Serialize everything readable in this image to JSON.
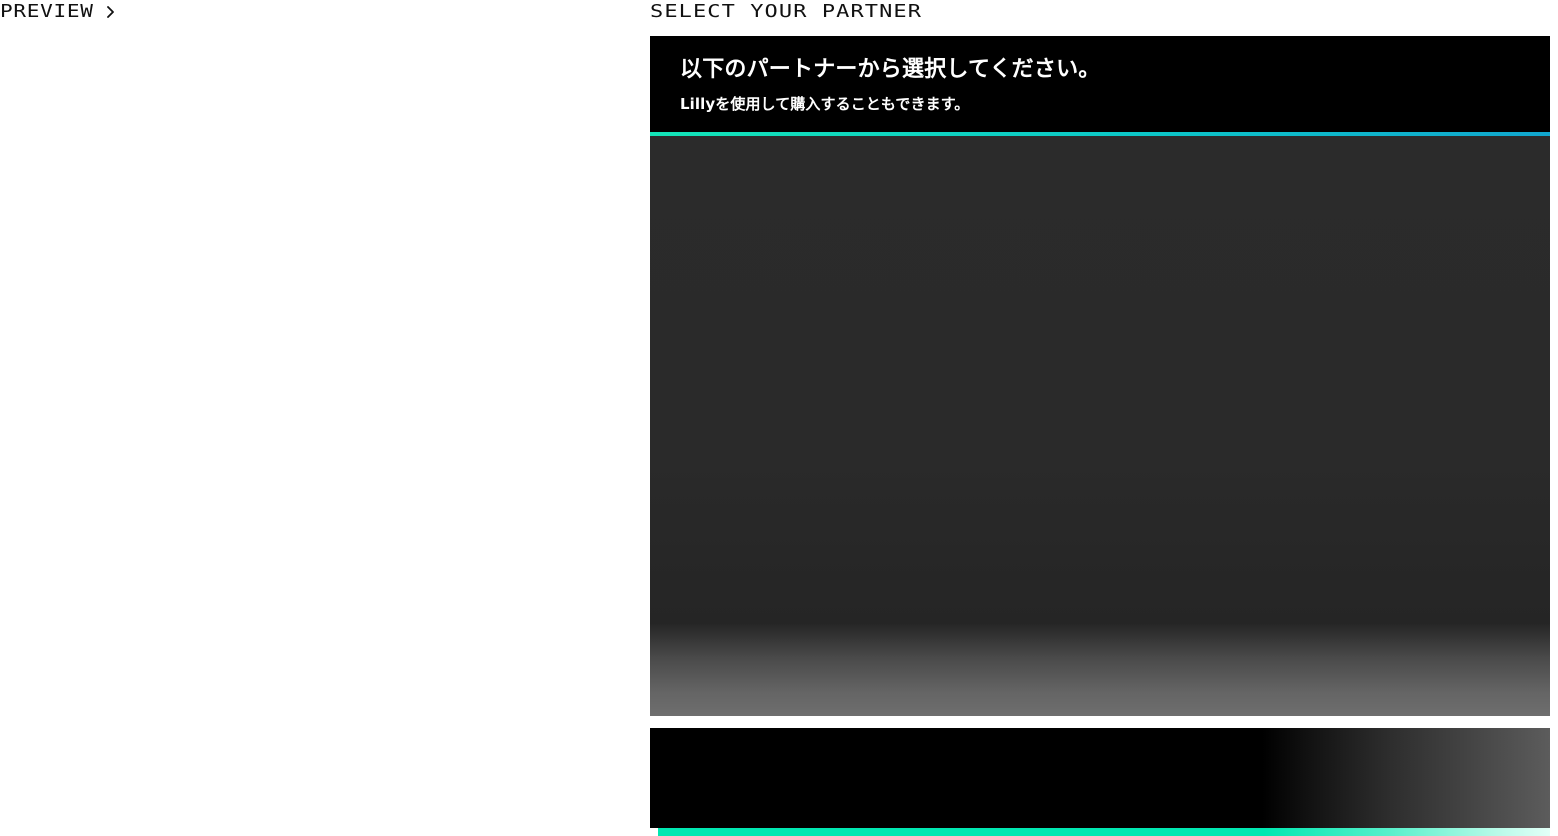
{
  "left": {
    "preview_label": "PREVIEW",
    "preview_icon": "chevron-right-icon"
  },
  "right": {
    "section_title": "SELECT YOUR PARTNER",
    "partner_header": {
      "title": "以下のパートナーから選択してください。",
      "subtitle": "Lillyを使用して購入することもできます。"
    }
  },
  "colors": {
    "background": "#ffffff",
    "card": "#000000",
    "card_body": "#2b2b2b",
    "accent": "#13e5b8",
    "accent_secondary": "#11a6ce",
    "bottom_accent": "#00e7b1"
  }
}
